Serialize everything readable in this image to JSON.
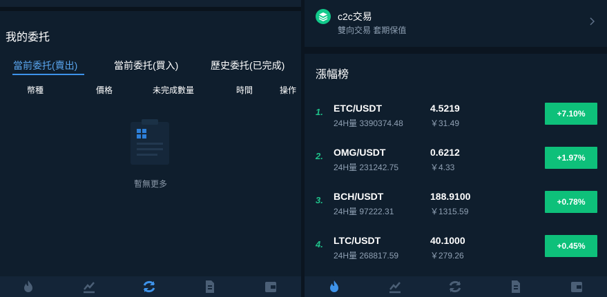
{
  "left": {
    "title": "我的委托",
    "tabs": [
      {
        "label": "當前委托(賣出)"
      },
      {
        "label": "當前委托(買入)"
      },
      {
        "label": "歷史委托(已完成)"
      }
    ],
    "columns": [
      "幣種",
      "價格",
      "未完成數量",
      "時間",
      "操作"
    ],
    "empty_text": "暫無更多"
  },
  "right": {
    "c2c": {
      "title": "c2c交易",
      "subtitle": "雙向交易 套期保值"
    },
    "ranking_title": "漲幅榜",
    "rows": [
      {
        "rank": "1.",
        "pair": "ETC/USDT",
        "volume": "24H量 3390374.48",
        "price": "4.5219",
        "cny": "￥31.49",
        "change": "+7.10%"
      },
      {
        "rank": "2.",
        "pair": "OMG/USDT",
        "volume": "24H量 231242.75",
        "price": "0.6212",
        "cny": "￥4.33",
        "change": "+1.97%"
      },
      {
        "rank": "3.",
        "pair": "BCH/USDT",
        "volume": "24H量 97222.31",
        "price": "188.9100",
        "cny": "￥1315.59",
        "change": "+0.78%"
      },
      {
        "rank": "4.",
        "pair": "LTC/USDT",
        "volume": "24H量 268817.59",
        "price": "40.1000",
        "cny": "￥279.26",
        "change": "+0.45%"
      }
    ]
  },
  "nav_icons": [
    "fire-icon",
    "chart-icon",
    "refresh-icon",
    "document-icon",
    "wallet-icon"
  ],
  "colors": {
    "accent_blue": "#3e93ea",
    "up_green": "#0ec07a",
    "panel_bg": "#0f1e2d",
    "nav_bg": "#142538"
  }
}
